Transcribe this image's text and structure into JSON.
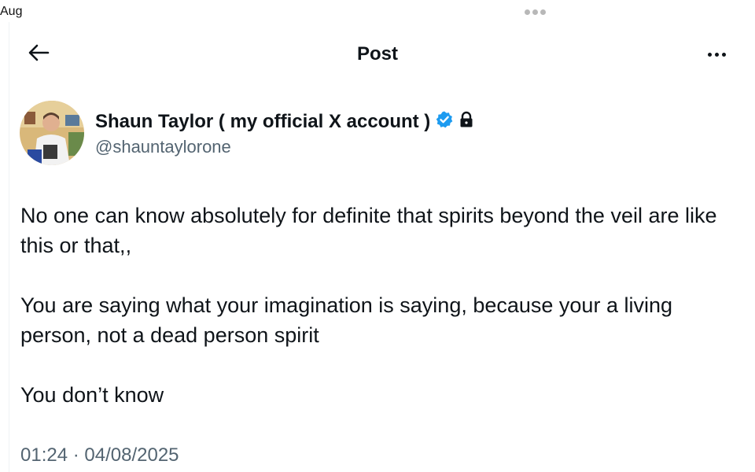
{
  "status_bar": {
    "month_fragment": "Aug"
  },
  "header": {
    "title": "Post"
  },
  "author": {
    "display_name": "Shaun Taylor ( my official X account )",
    "handle": "@shauntaylorone",
    "verified_badge_color": "#1d9bf0"
  },
  "icons": {
    "back": "arrow-left-icon",
    "more": "more-horizontal-icon",
    "verified": "verified-badge-icon",
    "protected": "lock-icon"
  },
  "tweet": {
    "paragraphs": [
      "No one can know absolutely for definite that spirits beyond the veil are like this or that,,",
      "You are saying what your imagination is saying, because your a living person, not a dead person spirit",
      "You don’t know"
    ],
    "time": "01:24",
    "separator": "·",
    "date": "04/08/2025"
  }
}
